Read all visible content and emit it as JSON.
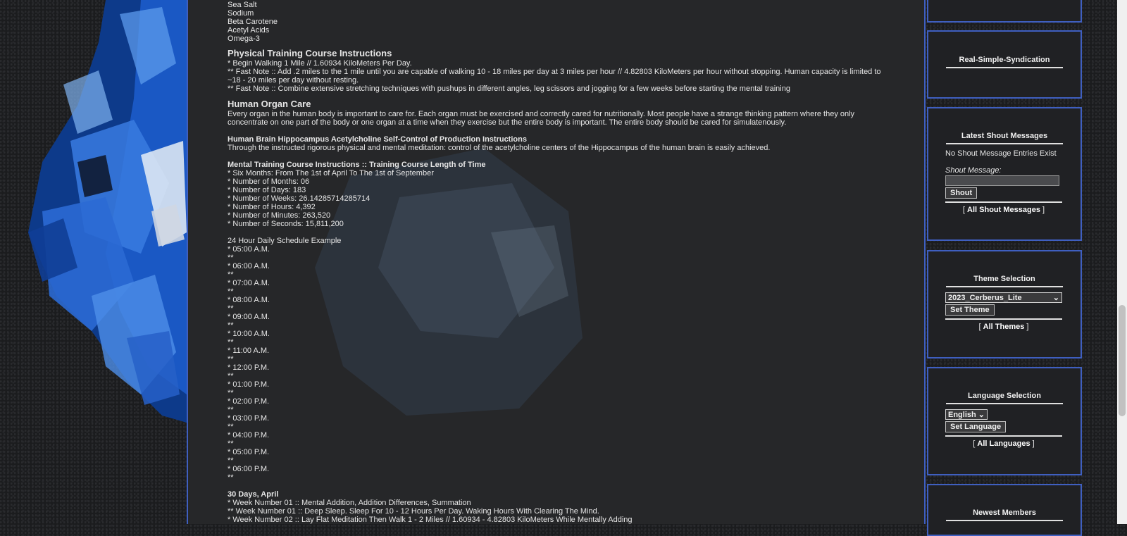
{
  "content": {
    "ingredients": [
      "Sea Salt",
      "Sodium",
      "Beta Carotene",
      "Acetyl Acids",
      "Omega-3"
    ],
    "physical": {
      "heading": "Physical Training Course Instructions",
      "lines": [
        "* Begin Walking 1 Mile // 1.60934 KiloMeters Per Day.",
        "** Fast Note :: Add .2 miles to the 1 mile until you are capable of walking 10 - 18 miles per day at 3 miles per hour // 4.82803 KiloMeters per hour without stopping. Human capacity is limited to ~18 - 20 miles per day without resting.",
        "** Fast Note :: Combine extensive stretching techniques with pushups in different angles, leg scissors and jogging for a few weeks before starting the mental training"
      ]
    },
    "organ": {
      "heading": "Human Organ Care",
      "text": "Every organ in the human body is important to care for. Each organ must be exercised and correctly cared for nutritionally. Most people have a strange thinking pattern where they only concentrate on one part of the body or one organ at a time when they exercise but the entire body is important. The entire body should be cared for simulatenously."
    },
    "brain": {
      "heading": "Human Brain Hippocampus Acetylcholine Self-Control of Production Instructions",
      "text": "Through the instructed rigorous physical and mental meditation: control of the acetylcholine centers of the Hippocampus of the human brain is easily achieved."
    },
    "mental": {
      "heading": "Mental Training Course Instructions :: Training Course Length of Time",
      "lines": [
        "* Six Months: From The 1st of April To The 1st of September",
        "* Number of Months: 06",
        "* Number of Days: 183",
        "* Number of Weeks: 26.14285714285714",
        "* Number of Hours: 4,392",
        "* Number of Minutes: 263,520",
        "* Number of Seconds: 15,811,200"
      ]
    },
    "schedule": {
      "title": "24 Hour Daily Schedule Example",
      "marker": "**",
      "times": [
        "* 05:00 A.M.",
        "* 06:00 A.M.",
        "* 07:00 A.M.",
        "* 08:00 A.M.",
        "* 09:00 A.M.",
        "* 10:00 A.M.",
        "* 11:00 A.M.",
        "* 12:00 P.M.",
        "* 01:00 P.M.",
        "* 02:00 P.M.",
        "* 03:00 P.M.",
        "* 04:00 P.M.",
        "* 05:00 P.M.",
        "* 06:00 P.M."
      ]
    },
    "april": {
      "heading": "30 Days, April",
      "lines": [
        "* Week Number 01 :: Mental Addition, Addition Differences, Summation",
        "** Week Number 01 :: Deep Sleep. Sleep For 10 - 12 Hours Per Day. Waking Hours With Clearing The Mind.",
        "* Week Number 02 :: Lay Flat Meditation Then Walk 1 - 2 Miles // 1.60934 - 4.82803 KiloMeters While Mentally Adding"
      ]
    }
  },
  "sidebar": {
    "rss": {
      "title": "Real-Simple-Syndication"
    },
    "shout": {
      "title": "Latest Shout Messages",
      "empty": "No Shout Message Entries Exist",
      "label": "Shout Message:",
      "button": "Shout",
      "link_open": "[",
      "link": "All Shout Messages",
      "link_close": "]"
    },
    "theme": {
      "title": "Theme Selection",
      "selected": "2023_Cerberus_Lite",
      "button": "Set Theme",
      "link_open": "[",
      "link": "All Themes",
      "link_close": "]"
    },
    "language": {
      "title": "Language Selection",
      "selected": "English",
      "button": "Set Language",
      "link_open": "[",
      "link": "All Languages",
      "link_close": "]"
    },
    "members": {
      "title": "Newest Members"
    }
  },
  "colors": {
    "border": "#3f5fc0",
    "accent_blue": "#1e5fd0"
  }
}
